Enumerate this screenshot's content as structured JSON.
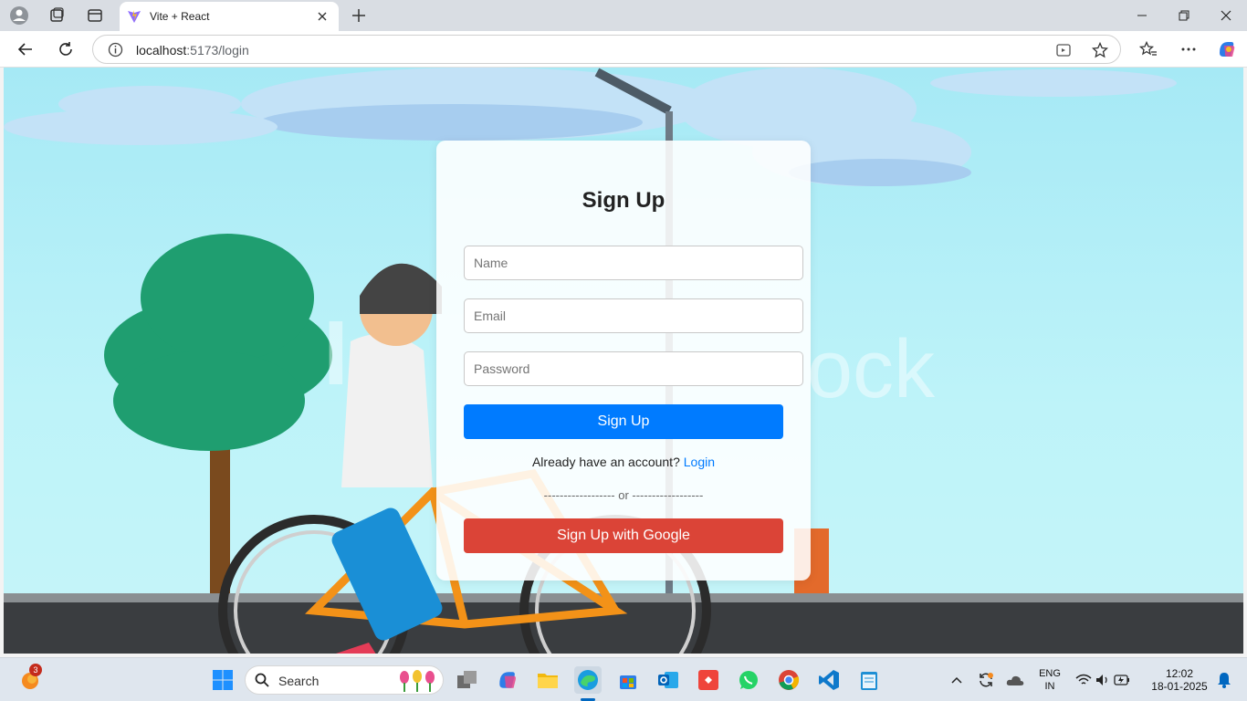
{
  "browser": {
    "tab_title": "Vite + React",
    "url_host": "localhost",
    "url_path": ":5173/login"
  },
  "signup": {
    "title": "Sign Up",
    "name_placeholder": "Name",
    "email_placeholder": "Email",
    "password_placeholder": "Password",
    "submit_label": "Sign Up",
    "have_account_text": "Already have an account?",
    "login_link": "Login",
    "divider_text": "------------------ or ------------------",
    "google_label": "Sign Up with Google"
  },
  "taskbar": {
    "search_label": "Search",
    "notification_count": "3",
    "lang_top": "ENG",
    "lang_bottom": "IN",
    "time": "12:02",
    "date": "18-01-2025"
  },
  "colors": {
    "primary": "#007bff",
    "google": "#db4437"
  }
}
